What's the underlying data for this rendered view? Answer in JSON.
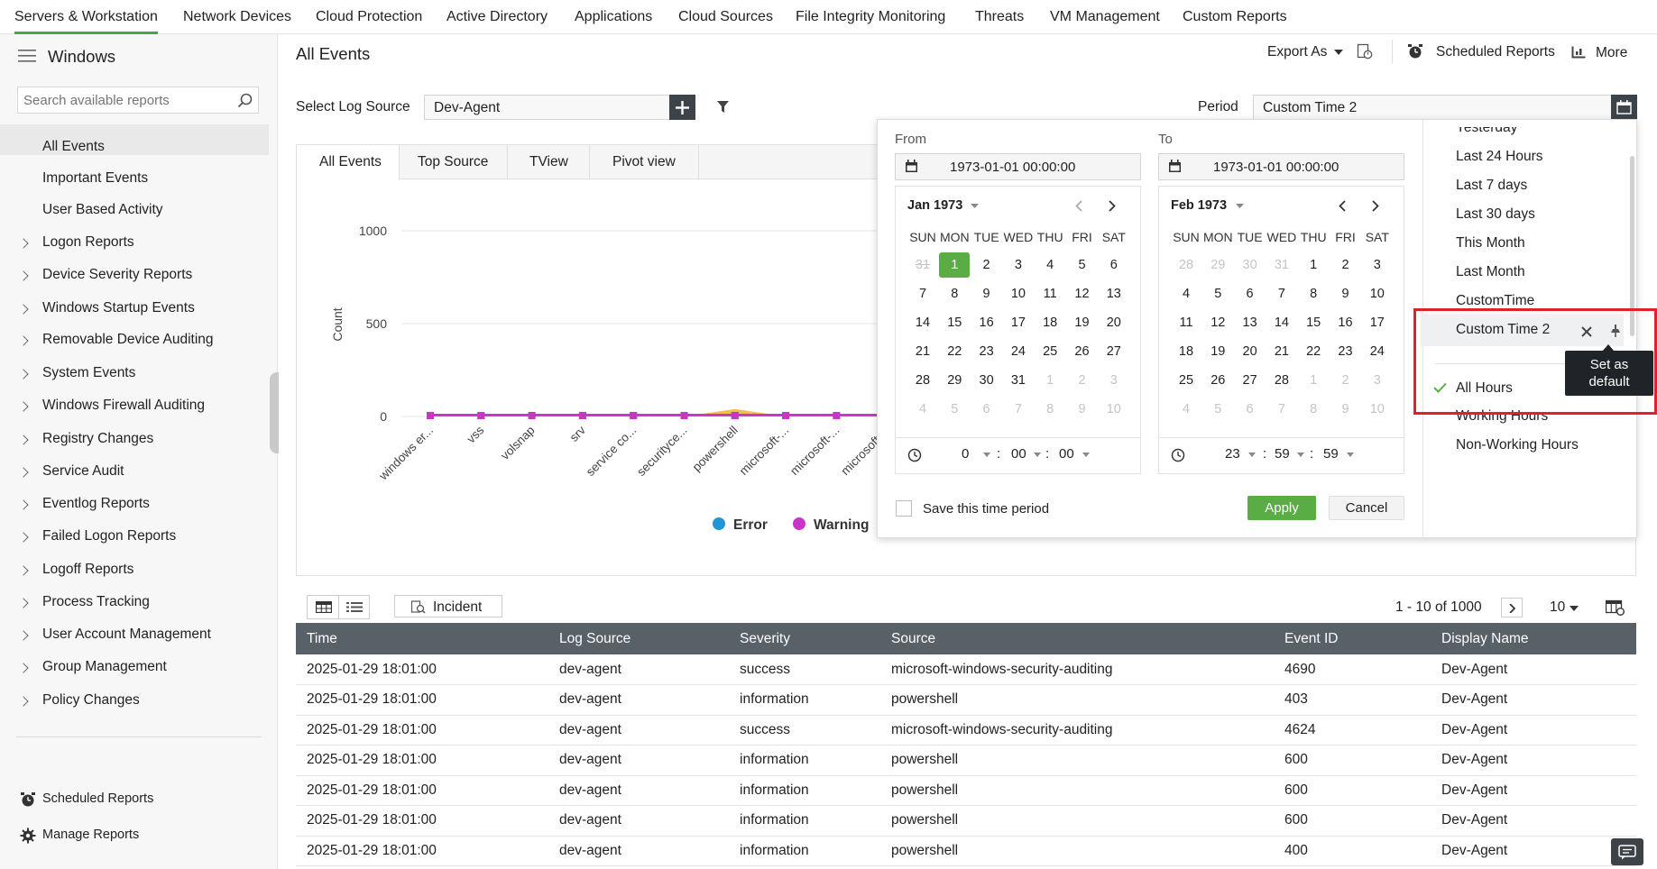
{
  "top_nav": {
    "tabs": [
      "Servers & Workstation",
      "Network Devices",
      "Cloud Protection",
      "Active Directory",
      "Applications",
      "Cloud Sources",
      "File Integrity Monitoring",
      "Threats",
      "VM Management",
      "Custom Reports"
    ]
  },
  "sidebar": {
    "title": "Windows",
    "search_placeholder": "Search available reports",
    "items": [
      {
        "label": "All Events",
        "active": true,
        "expandable": false
      },
      {
        "label": "Important Events",
        "active": false,
        "expandable": false
      },
      {
        "label": "User Based Activity",
        "active": false,
        "expandable": false
      },
      {
        "label": "Logon Reports",
        "active": false,
        "expandable": true
      },
      {
        "label": "Device Severity Reports",
        "active": false,
        "expandable": true
      },
      {
        "label": "Windows Startup Events",
        "active": false,
        "expandable": true
      },
      {
        "label": "Removable Device Auditing",
        "active": false,
        "expandable": true
      },
      {
        "label": "System Events",
        "active": false,
        "expandable": true
      },
      {
        "label": "Windows Firewall Auditing",
        "active": false,
        "expandable": true
      },
      {
        "label": "Registry Changes",
        "active": false,
        "expandable": true
      },
      {
        "label": "Service Audit",
        "active": false,
        "expandable": true
      },
      {
        "label": "Eventlog Reports",
        "active": false,
        "expandable": true
      },
      {
        "label": "Failed Logon Reports",
        "active": false,
        "expandable": true
      },
      {
        "label": "Logoff Reports",
        "active": false,
        "expandable": true
      },
      {
        "label": "Process Tracking",
        "active": false,
        "expandable": true
      },
      {
        "label": "User Account Management",
        "active": false,
        "expandable": true
      },
      {
        "label": "Group Management",
        "active": false,
        "expandable": true
      },
      {
        "label": "Policy Changes",
        "active": false,
        "expandable": true
      }
    ],
    "footer": {
      "scheduled": "Scheduled Reports",
      "manage": "Manage Reports"
    }
  },
  "header": {
    "title": "All Events",
    "export_label": "Export As",
    "scheduled_label": "Scheduled Reports",
    "more_label": "More"
  },
  "filters": {
    "log_source_label": "Select Log Source",
    "log_source_value": "Dev-Agent",
    "period_label": "Period",
    "period_value": "Custom Time 2"
  },
  "view_tabs": [
    "All Events",
    "Top Source",
    "TView",
    "Pivot view"
  ],
  "chart_data": {
    "type": "line",
    "ylabel": "Count",
    "ylim": [
      0,
      1000
    ],
    "yticks": [
      "1000",
      "500",
      "0"
    ],
    "categories": [
      "windows er...",
      "vss",
      "volsnap",
      "srv",
      "service co...",
      "securityce...",
      "powershell",
      "microsoft-...",
      "microsoft-...",
      "microsoft-..."
    ],
    "series": [
      {
        "name": "Error",
        "color": "#2196d3",
        "values": [
          5,
          5,
          5,
          5,
          5,
          5,
          5,
          5,
          5,
          5
        ]
      },
      {
        "name": "Warning",
        "color": "#c936c7",
        "values": [
          5,
          5,
          5,
          5,
          5,
          5,
          5,
          5,
          5,
          5
        ]
      },
      {
        "name": "",
        "color": "#f2b233",
        "values": [
          0,
          0,
          0,
          0,
          0,
          0,
          40,
          0,
          0,
          0
        ]
      }
    ],
    "legend_position": "bottom"
  },
  "table_toolbar": {
    "incident_label": "Incident",
    "pagination": "1 - 10 of 1000",
    "page_size": "10"
  },
  "table": {
    "columns": [
      "Time",
      "Log Source",
      "Severity",
      "Source",
      "Event ID",
      "Display Name"
    ],
    "rows": [
      [
        "2025-01-29 18:01:00",
        "dev-agent",
        "success",
        "microsoft-windows-security-auditing",
        "4690",
        "Dev-Agent"
      ],
      [
        "2025-01-29 18:01:00",
        "dev-agent",
        "information",
        "powershell",
        "403",
        "Dev-Agent"
      ],
      [
        "2025-01-29 18:01:00",
        "dev-agent",
        "success",
        "microsoft-windows-security-auditing",
        "4624",
        "Dev-Agent"
      ],
      [
        "2025-01-29 18:01:00",
        "dev-agent",
        "information",
        "powershell",
        "600",
        "Dev-Agent"
      ],
      [
        "2025-01-29 18:01:00",
        "dev-agent",
        "information",
        "powershell",
        "600",
        "Dev-Agent"
      ],
      [
        "2025-01-29 18:01:00",
        "dev-agent",
        "information",
        "powershell",
        "600",
        "Dev-Agent"
      ],
      [
        "2025-01-29 18:01:00",
        "dev-agent",
        "information",
        "powershell",
        "400",
        "Dev-Agent"
      ]
    ]
  },
  "date_picker": {
    "from_label": "From",
    "to_label": "To",
    "from_value": "1973-01-01 00:00:00",
    "to_value": "1973-01-01 00:00:00",
    "weekdays": [
      "SUN",
      "MON",
      "TUE",
      "WED",
      "THU",
      "FRI",
      "SAT"
    ],
    "left_month": {
      "title": "Jan 1973",
      "days": [
        [
          "31",
          "1",
          "2",
          "3",
          "4",
          "5",
          "6"
        ],
        [
          "7",
          "8",
          "9",
          "10",
          "11",
          "12",
          "13"
        ],
        [
          "14",
          "15",
          "16",
          "17",
          "18",
          "19",
          "20"
        ],
        [
          "21",
          "22",
          "23",
          "24",
          "25",
          "26",
          "27"
        ],
        [
          "28",
          "29",
          "30",
          "31",
          "1",
          "2",
          "3"
        ],
        [
          "4",
          "5",
          "6",
          "7",
          "8",
          "9",
          "10"
        ]
      ]
    },
    "right_month": {
      "title": "Feb 1973",
      "days": [
        [
          "28",
          "29",
          "30",
          "31",
          "1",
          "2",
          "3"
        ],
        [
          "4",
          "5",
          "6",
          "7",
          "8",
          "9",
          "10"
        ],
        [
          "11",
          "12",
          "13",
          "14",
          "15",
          "16",
          "17"
        ],
        [
          "18",
          "19",
          "20",
          "21",
          "22",
          "23",
          "24"
        ],
        [
          "25",
          "26",
          "27",
          "28",
          "1",
          "2",
          "3"
        ],
        [
          "4",
          "5",
          "6",
          "7",
          "8",
          "9",
          "10"
        ]
      ]
    },
    "from_time": {
      "h": "0",
      "m": "00",
      "s": "00"
    },
    "to_time": {
      "h": "23",
      "m": "59",
      "s": "59"
    },
    "save_label": "Save this time period",
    "apply_label": "Apply",
    "cancel_label": "Cancel",
    "presets": [
      "Yesterday",
      "Last 24 Hours",
      "Last 7 days",
      "Last 30 days",
      "This Month",
      "Last Month",
      "CustomTime",
      "Custom Time 2"
    ],
    "hours": [
      "All Hours",
      "Working Hours",
      "Non-Working Hours"
    ],
    "tooltip": "Set as default",
    "highlight_color": "#e0202a"
  }
}
